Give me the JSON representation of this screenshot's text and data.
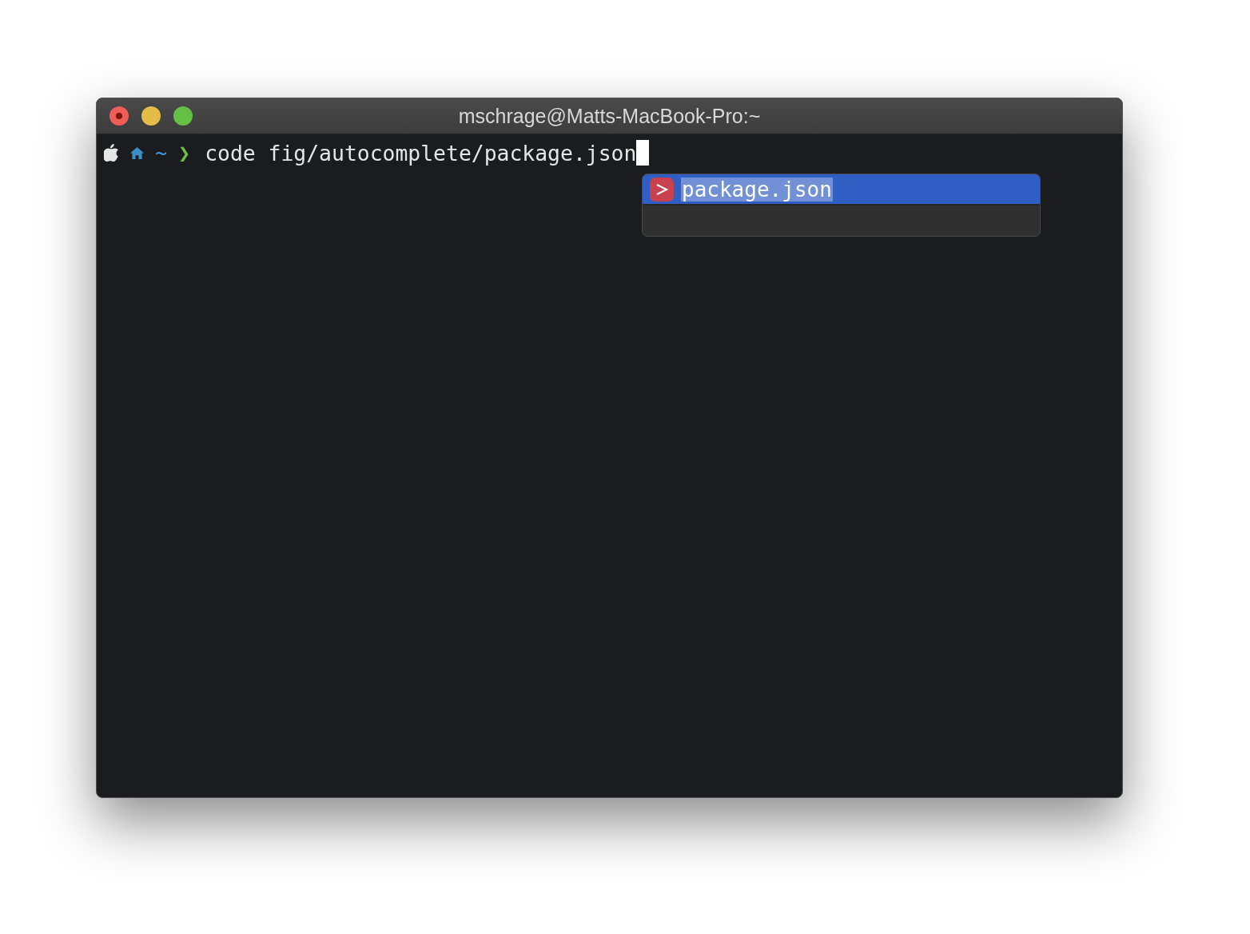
{
  "window": {
    "title": "mschrage@Matts-MacBook-Pro:~"
  },
  "prompt": {
    "directory": "~",
    "symbol": "❯",
    "command": "code fig/autocomplete/package.json"
  },
  "suggestions": [
    {
      "label": "package.json",
      "selected": true
    }
  ]
}
